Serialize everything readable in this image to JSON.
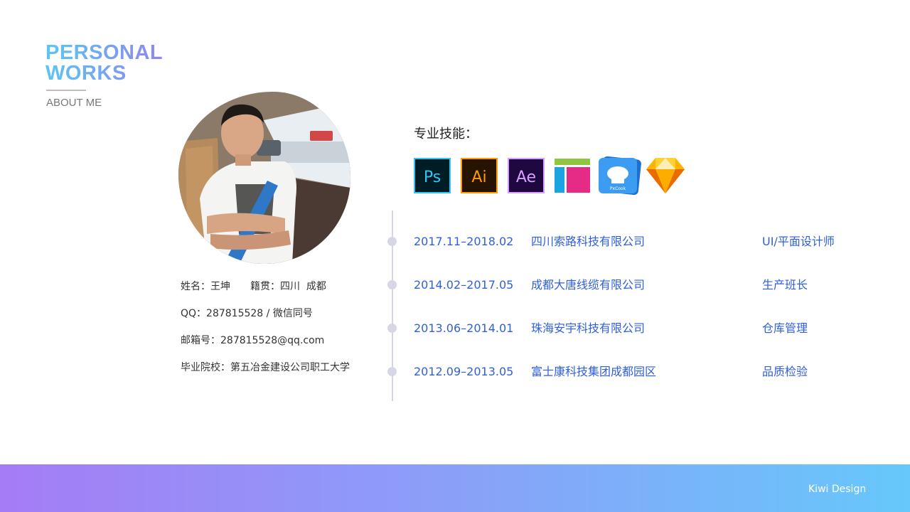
{
  "brand": {
    "line1": "PERSONAL",
    "line2": "WORKS",
    "subtitle": "ABOUT ME",
    "gradient_colors": [
      "#5bc6f2",
      "#8f86f0"
    ]
  },
  "profile": {
    "name_label": "姓名：",
    "name": "王坤",
    "origin_label": "籍贯：",
    "origin": "四川  成都",
    "qq_line": "QQ：287815528 / 微信同号",
    "email_line": "邮箱号：287815528@qq.com",
    "school_line": "毕业院校：第五冶金建设公司职工大学"
  },
  "skills": {
    "title": "专业技能：",
    "icons": [
      {
        "name": "photoshop-icon",
        "label": "Ps",
        "bg": "#001d26",
        "fg": "#31c5f0"
      },
      {
        "name": "illustrator-icon",
        "label": "Ai",
        "bg": "#261300",
        "fg": "#ff9a00"
      },
      {
        "name": "after-effects-icon",
        "label": "Ae",
        "bg": "#1f0740",
        "fg": "#d8a1ff"
      },
      {
        "name": "axure-icon",
        "label": "",
        "bg": "#ffffff",
        "fg": "#e62b86"
      },
      {
        "name": "pxcook-icon",
        "label": "PxCook",
        "bg": "#2a86e8",
        "fg": "#ffffff"
      },
      {
        "name": "sketch-icon",
        "label": "",
        "bg": "#fdb300",
        "fg": "#ea6c00"
      }
    ]
  },
  "experience": [
    {
      "date": "2017.11–2018.02",
      "company": "四川索路科技有限公司",
      "role": "UI/平面设计师"
    },
    {
      "date": "2014.02–2017.05",
      "company": "成都大唐线缆有限公司",
      "role": "生产班长"
    },
    {
      "date": "2013.06–2014.01",
      "company": "珠海安宇科技有限公司",
      "role": "仓库管理"
    },
    {
      "date": "2012.09–2013.05",
      "company": "富士康科技集团成都园区",
      "role": "品质检验"
    }
  ],
  "footer": {
    "text": "Kiwi Design",
    "gradient_colors": [
      "#a57cf6",
      "#66c8fb"
    ]
  },
  "colors": {
    "accent_blue": "#2f5fdc",
    "timeline": "#d6d6e2"
  }
}
